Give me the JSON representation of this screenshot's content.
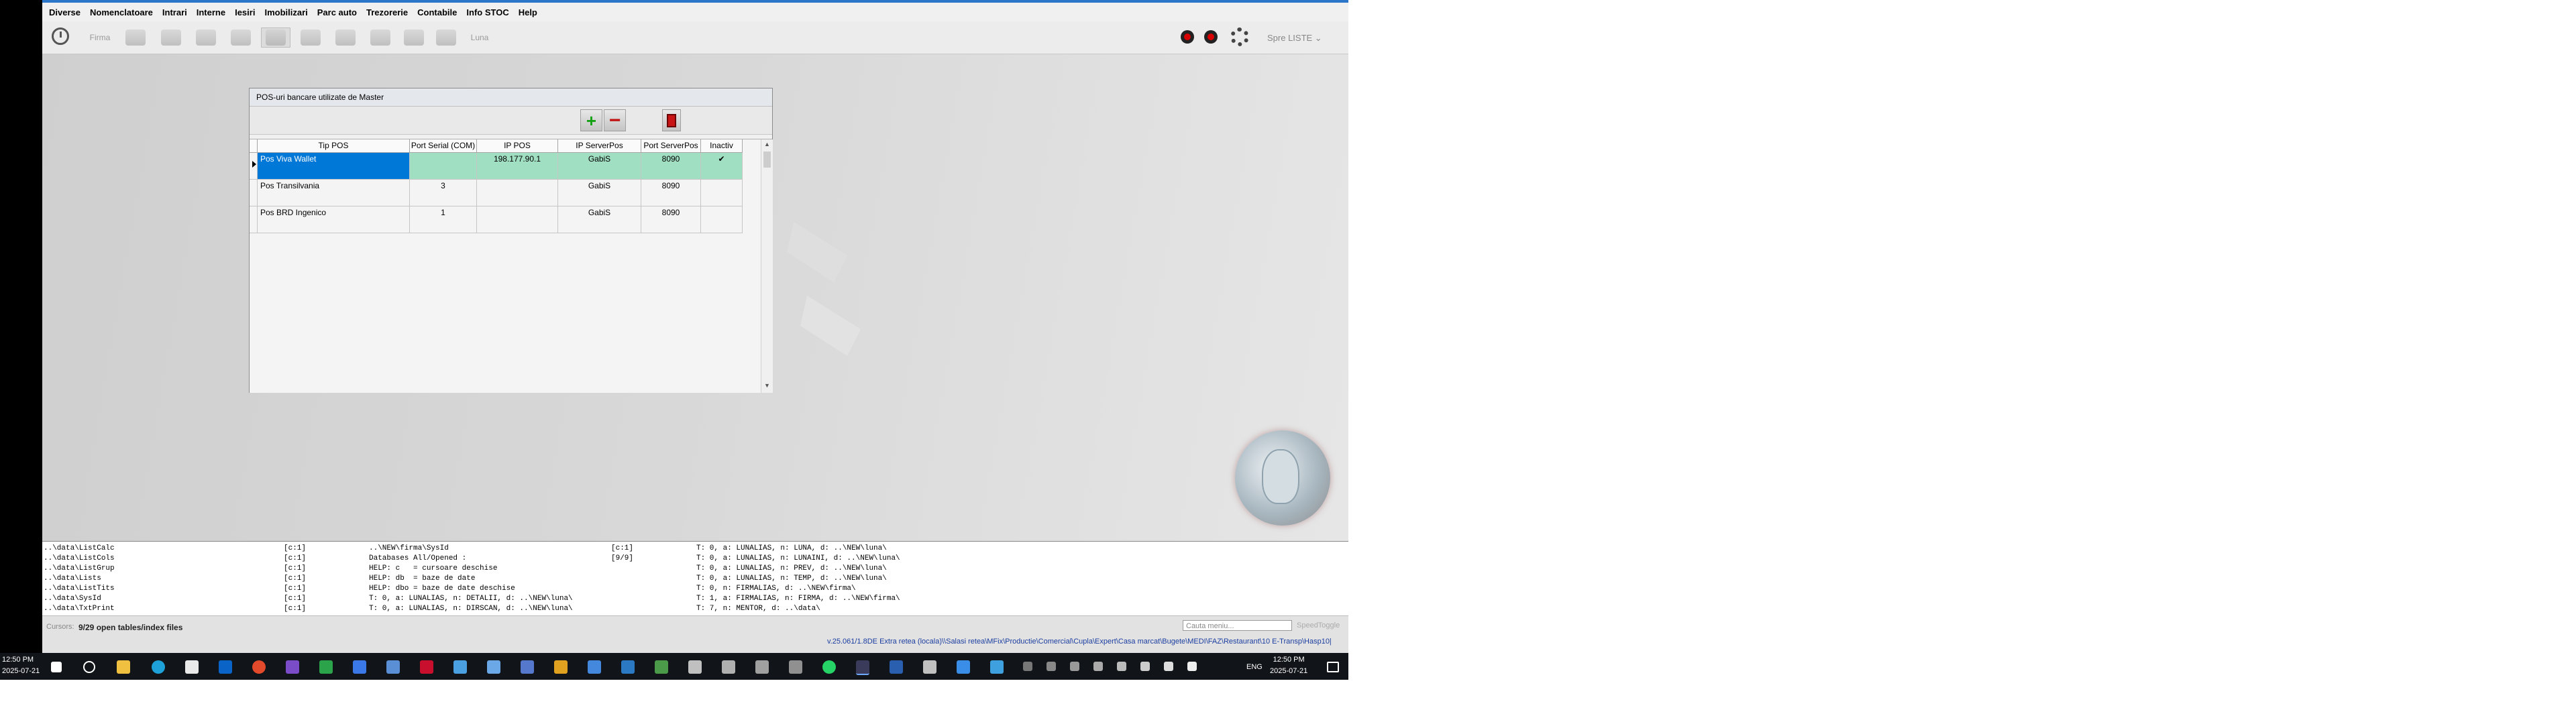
{
  "menu": [
    "Diverse",
    "Nomenclatoare",
    "Intrari",
    "Interne",
    "Iesiri",
    "Imobilizari",
    "Parc auto",
    "Trezorerie",
    "Contabile",
    "Info STOC",
    "Help"
  ],
  "toolbar": {
    "firma": "Firma",
    "luna": "Luna",
    "user": "Spre LISTE ⌄"
  },
  "dialog": {
    "title": "POS-uri bancare utilizate de Master",
    "columns": [
      "Tip POS",
      "Port Serial (COM)",
      "IP POS",
      "IP ServerPos",
      "Port ServerPos",
      "Inactiv"
    ],
    "rows": [
      {
        "tip": "Pos Viva Wallet",
        "port_serial": "",
        "ip_pos": "198.177.90.1",
        "ip_server": "GabiS",
        "port_server": "8090",
        "inactiv": "✔"
      },
      {
        "tip": "Pos Transilvania",
        "port_serial": "3",
        "ip_pos": "",
        "ip_server": "GabiS",
        "port_server": "8090",
        "inactiv": ""
      },
      {
        "tip": "Pos BRD Ingenico",
        "port_serial": "1",
        "ip_pos": "",
        "ip_server": "GabiS",
        "port_server": "8090",
        "inactiv": ""
      }
    ]
  },
  "log": [
    [
      "..\\data\\ListCalc",
      "[c:1]",
      "..\\NEW\\firma\\SysId",
      "[c:1]",
      "T: 0, a: LUNALIAS, n: LUNA, d: ..\\NEW\\luna\\"
    ],
    [
      "..\\data\\ListCols",
      "[c:1]",
      "Databases All/Opened :",
      "[9/9]",
      "T: 0, a: LUNALIAS, n: LUNAINI, d: ..\\NEW\\luna\\"
    ],
    [
      "..\\data\\ListGrup",
      "[c:1]",
      "HELP: c   = cursoare deschise",
      "",
      "T: 0, a: LUNALIAS, n: PREV, d: ..\\NEW\\luna\\"
    ],
    [
      "..\\data\\Lists",
      "[c:1]",
      "HELP: db  = baze de date",
      "",
      "T: 0, a: LUNALIAS, n: TEMP, d: ..\\NEW\\luna\\"
    ],
    [
      "..\\data\\ListTits",
      "[c:1]",
      "HELP: dbo = baze de date deschise",
      "",
      "T: 0, n: FIRMALIAS, d: ..\\NEW\\firma\\"
    ],
    [
      "..\\data\\SysId",
      "[c:1]",
      "T: 0, a: LUNALIAS, n: DETALII, d: ..\\NEW\\luna\\",
      "",
      "T: 1, a: FIRMALIAS, n: FIRMA, d: ..\\NEW\\firma\\"
    ],
    [
      "..\\data\\TxtPrint",
      "[c:1]",
      "T: 0, a: LUNALIAS, n: DIRSCAN, d: ..\\NEW\\luna\\",
      "",
      "T: 7, n: MENTOR, d: ..\\data\\"
    ]
  ],
  "status": {
    "cursors_label": "Cursors:",
    "cursors_value": "9/29 open tables/index files",
    "search_placeholder": "Cauta meniu...",
    "speed": "SpeedToggle",
    "version": "v.25.061/1.8DE  Extra retea (locala)\\\\Salasi retea\\MFix\\Productie\\Comercial\\Cupla\\Expert\\Casa marcat\\Bugete\\MEDI\\FAZ\\Restaurant\\10 E-Transp\\Hasp10|"
  },
  "taskbar": {
    "time_left": "12:50 PM",
    "date_left": "2025-07-21",
    "lang": "ENG",
    "time_right": "12:50 PM",
    "date_right": "2025-07-21"
  },
  "colors": {
    "accent": "#0078d7",
    "row_highlight": "#a1dfc3",
    "titlebar": "#2b76c8"
  }
}
